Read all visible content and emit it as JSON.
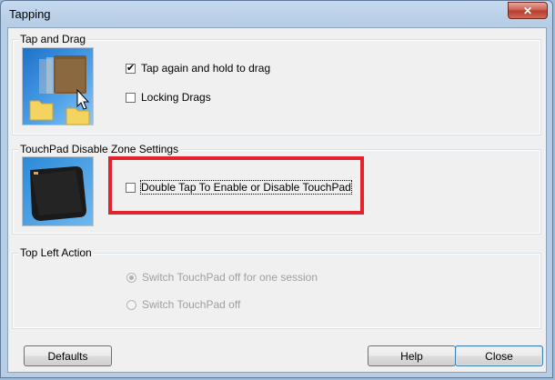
{
  "window": {
    "title": "Tapping",
    "close_icon": "close-x-icon",
    "close_glyph": "✕"
  },
  "tap_and_drag": {
    "title": "Tap and Drag",
    "image_icon": "folders-drag-icon",
    "tap_hold_drag": {
      "label": "Tap again and hold to drag",
      "checked": true
    },
    "locking_drags": {
      "label": "Locking Drags",
      "checked": false
    }
  },
  "disable_zone": {
    "title": "TouchPad Disable Zone Settings",
    "image_icon": "touchpad-icon",
    "double_tap": {
      "label": "Double Tap To Enable or Disable TouchPad",
      "checked": false
    },
    "highlight_color": "#e4222e"
  },
  "top_left_action": {
    "title": "Top Left Action",
    "options": [
      {
        "label": "Switch TouchPad off for one session",
        "selected": true,
        "enabled": false
      },
      {
        "label": "Switch TouchPad off",
        "selected": false,
        "enabled": false
      }
    ]
  },
  "buttons": {
    "defaults": "Defaults",
    "help": "Help",
    "close": "Close"
  }
}
